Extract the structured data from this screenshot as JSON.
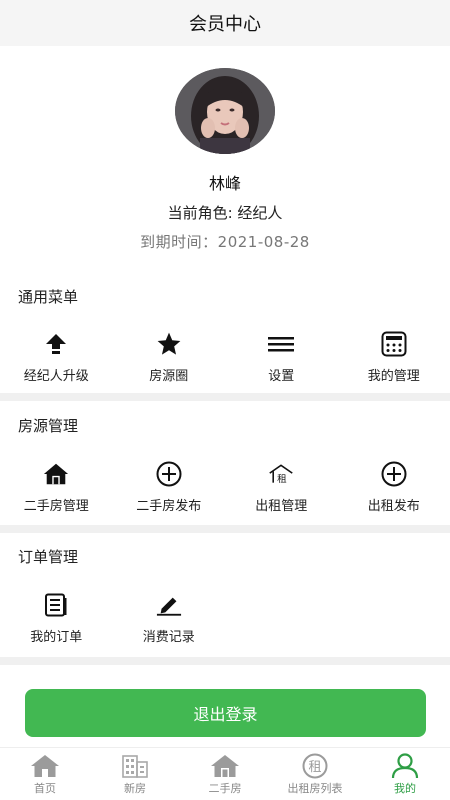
{
  "header": {
    "title": "会员中心"
  },
  "profile": {
    "name": "林峰",
    "role_line": "当前角色: 经纪人",
    "expire_label": "到期时间：",
    "expire_date": "2021-08-28"
  },
  "sections": [
    {
      "title": "通用菜单",
      "items": [
        {
          "label": "经纪人升级",
          "icon": "upgrade-arrow-icon"
        },
        {
          "label": "房源圈",
          "icon": "star-icon"
        },
        {
          "label": "设置",
          "icon": "menu-lines-icon"
        },
        {
          "label": "我的管理",
          "icon": "calculator-icon"
        }
      ]
    },
    {
      "title": "房源管理",
      "items": [
        {
          "label": "二手房管理",
          "icon": "house-icon"
        },
        {
          "label": "二手房发布",
          "icon": "plus-circle-icon"
        },
        {
          "label": "出租管理",
          "icon": "rent-house-icon"
        },
        {
          "label": "出租发布",
          "icon": "plus-circle-icon"
        }
      ]
    },
    {
      "title": "订单管理",
      "items": [
        {
          "label": "我的订单",
          "icon": "document-icon"
        },
        {
          "label": "消费记录",
          "icon": "edit-icon"
        }
      ]
    }
  ],
  "logout": {
    "label": "退出登录"
  },
  "tabbar": {
    "items": [
      {
        "label": "首页",
        "icon": "home-icon"
      },
      {
        "label": "新房",
        "icon": "building-icon"
      },
      {
        "label": "二手房",
        "icon": "house-icon"
      },
      {
        "label": "出租房列表",
        "icon": "rent-circle-icon"
      },
      {
        "label": "我的",
        "icon": "user-icon"
      }
    ],
    "active_index": 4
  },
  "colors": {
    "accent": "#42b852",
    "tab_active": "#2e9e45",
    "tab_inactive": "#888888"
  }
}
